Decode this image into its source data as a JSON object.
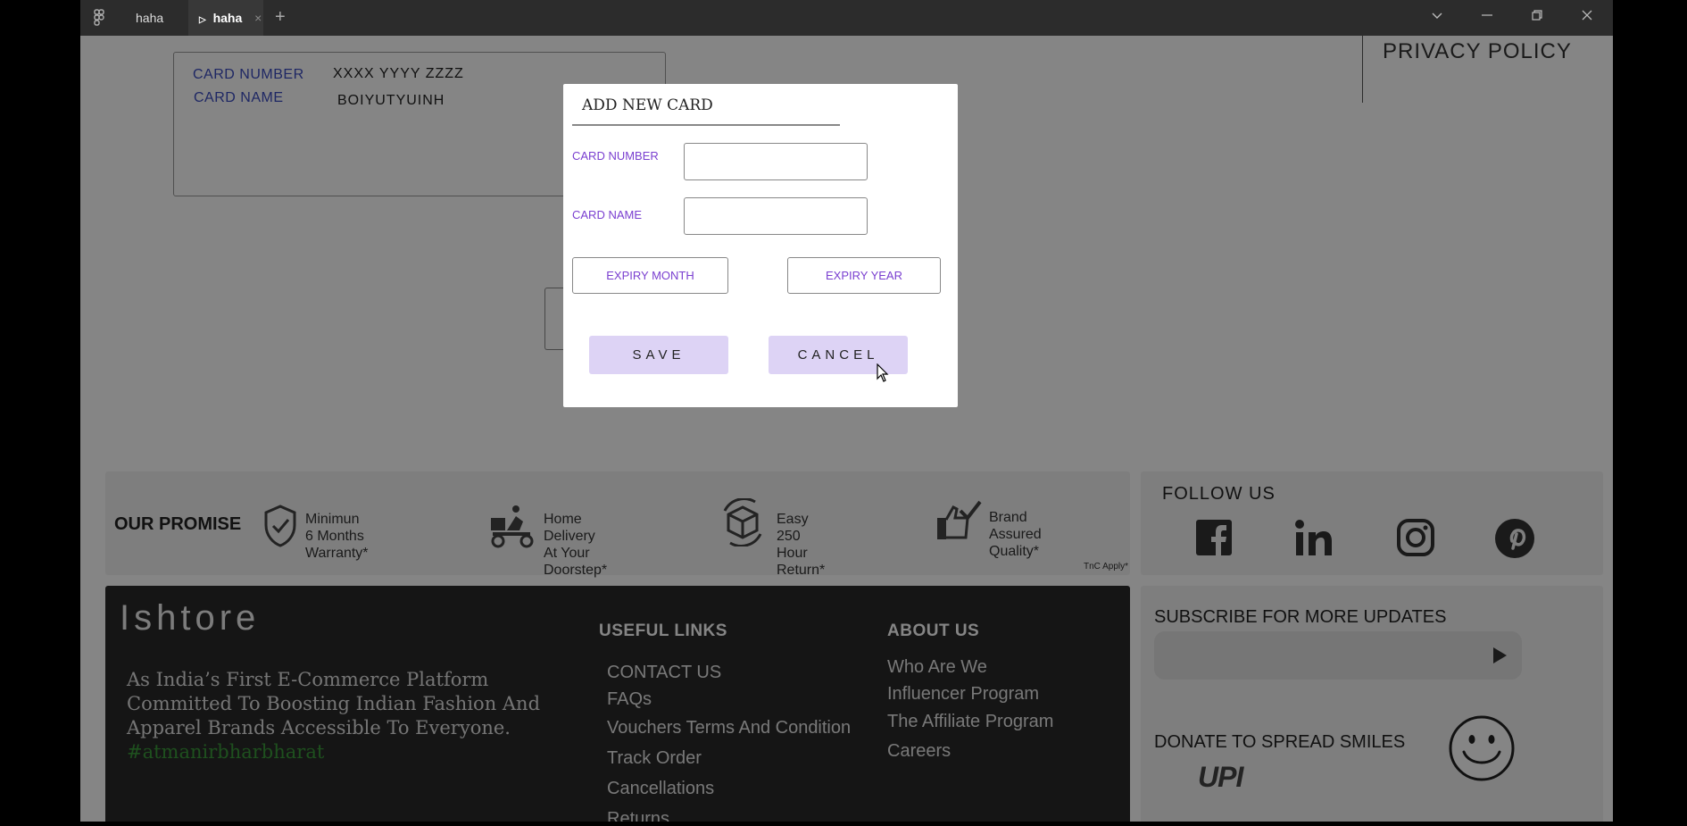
{
  "titlebar": {
    "tabs": [
      {
        "label": "haha"
      },
      {
        "label": "haha"
      }
    ],
    "new_tab_glyph": "+",
    "close_glyph": "×",
    "icons": [
      "figma-menu-icon",
      "play-icon",
      "chevron-down-icon",
      "minimize-icon",
      "restore-icon",
      "close-icon"
    ]
  },
  "card": {
    "number_label": "CARD NUMBER",
    "number_value": "XXXX YYYY ZZZZ",
    "name_label": "CARD NAME",
    "name_value": "BOIYUTYUINH"
  },
  "header": {
    "privacy_policy": "PRIVACY POLICY"
  },
  "promise": {
    "title": "OUR PROMISE",
    "items": [
      {
        "icon": "shield-check-icon",
        "line1": "Minimun",
        "line2": "6 Months Warranty*"
      },
      {
        "icon": "delivery-scooter-icon",
        "line1": "Home Delivery",
        "line2": "At Your Doorstep*"
      },
      {
        "icon": "box-return-icon",
        "line1": "Easy",
        "line2": "250 Hour Return*"
      },
      {
        "icon": "quality-check-icon",
        "line1": "Brand",
        "line2": "Assured Quality*"
      }
    ],
    "tnc": "TnC Apply*"
  },
  "follow": {
    "title": "FOLLOW  US",
    "icons": [
      "facebook-icon",
      "linkedin-icon",
      "instagram-icon",
      "pinterest-icon"
    ]
  },
  "footer": {
    "brand": "Ishtore",
    "about": "As India’s First E-Commerce Platform Committed To Boosting Indian Fashion And Apparel Brands Accessible To Everyone.",
    "hashtag": "#atmanirbharbharat",
    "useful_links_title": "USEFUL LINKS",
    "useful_links": [
      "CONTACT US",
      "FAQs",
      "Vouchers Terms  And Condition",
      "Track Order",
      "Cancellations",
      "Returns"
    ],
    "about_title": "ABOUT US",
    "about_links": [
      "Who Are We",
      "Influencer Program",
      "The Affiliate Program",
      "Careers"
    ]
  },
  "subscribe": {
    "title": "SUBSCRIBE FOR MORE UPDATES",
    "input_value": "",
    "donate_title": "DONATE TO SPREAD SMILES",
    "upi_text": "UPI",
    "icons": [
      "send-arrow-icon",
      "smiley-icon"
    ]
  },
  "modal": {
    "title": "ADD NEW CARD",
    "card_number_label": "CARD NUMBER",
    "card_number_value": "",
    "card_name_label": "CARD NAME",
    "card_name_value": "",
    "expiry_month": "EXPIRY MONTH",
    "expiry_year": "EXPIRY YEAR",
    "save_label": "SAVE",
    "cancel_label": "CANCEL"
  },
  "colors": {
    "accent_purple": "#7a3fd0",
    "button_lavender": "#ddd3f5",
    "card_label_blue": "#3b4cc0",
    "hashtag_green": "#3a9a3a",
    "footer_dark": "#2a2a2a"
  }
}
